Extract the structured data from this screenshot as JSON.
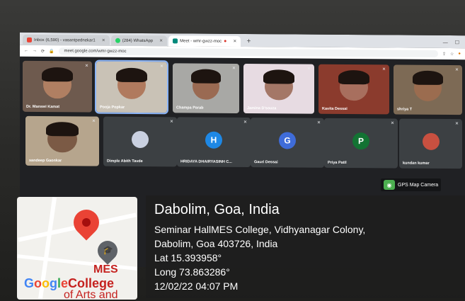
{
  "browser": {
    "tabs": [
      {
        "label": "Inbox (6,590) - vasantpednekar1",
        "fav": "#ea4335",
        "fav_name": "gmail-icon",
        "active": false
      },
      {
        "label": "(284) WhatsApp",
        "fav": "#25d366",
        "fav_name": "whatsapp-icon",
        "active": false
      },
      {
        "label": "Meet - wmr-gwzz-moc",
        "fav": "#00897b",
        "fav_name": "meet-icon",
        "active": true
      }
    ],
    "new_tab": "+",
    "url": "meet.google.com/wmr-gwzz-moc"
  },
  "participants": [
    {
      "name": "Dr. Manswi Kamat",
      "type": "video",
      "bg": "#6e5a4e",
      "skin": "#b07f62"
    },
    {
      "name": "Pooja Popkar",
      "type": "video",
      "bg": "#c9c2b6",
      "skin": "#b07a5e",
      "active": true
    },
    {
      "name": "Champa Parab",
      "type": "video",
      "bg": "#a8a8a5",
      "skin": "#9a6a52"
    },
    {
      "name": "Jamina D'souza",
      "type": "video",
      "bg": "#e7dbe2",
      "skin": "#a47767"
    },
    {
      "name": "Kavita Dessai",
      "type": "video",
      "bg": "#8b3b2d",
      "skin": "#a86f5e"
    },
    {
      "name": "shriya T",
      "type": "video",
      "bg": "#7d6a55",
      "skin": "#9b6c4f"
    },
    {
      "name": "sandeep Gaonkar",
      "type": "video",
      "bg": "#b6a58d",
      "skin": "#7b5a45"
    },
    {
      "name": "Dimple Abith Tavde",
      "type": "photo",
      "bg": "#3c4043",
      "color": "#c9d0e0"
    },
    {
      "name": "HRIDAYA DHAIRYASINH C...",
      "type": "avatar",
      "letter": "H",
      "color": "#1e88e5"
    },
    {
      "name": "Gauri Dessai",
      "type": "avatar",
      "letter": "G",
      "color": "#3f6cd9"
    },
    {
      "name": "Priya Patil",
      "type": "avatar",
      "letter": "P",
      "color": "#137333"
    },
    {
      "name": "kundan kumar",
      "type": "photo",
      "bg": "#3c4043",
      "color": "#c85040"
    }
  ],
  "gps": {
    "badge": "GPS Map Camera",
    "map_label_1": "MES",
    "map_label_2": "College",
    "map_label_3": "of Arts and",
    "google": [
      "G",
      "o",
      "o",
      "g",
      "l",
      "e"
    ],
    "place": "Dabolim, Goa, India",
    "address_1": "Seminar HallMES College, Vidhyanagar Colony,",
    "address_2": "Dabolim, Goa 403726, India",
    "lat": "Lat 15.393958°",
    "long": "Long 73.863286°",
    "datetime": "12/02/22 04:07 PM"
  }
}
